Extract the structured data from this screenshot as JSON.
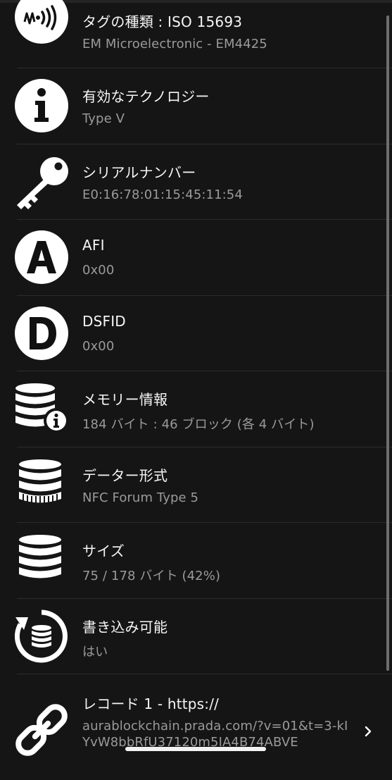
{
  "rows": [
    {
      "title": "タグの種類 : ISO 15693",
      "value": "EM Microelectronic - EM4425",
      "icon": "nfc-tag-icon"
    },
    {
      "title": "有効なテクノロジー",
      "value": "Type V",
      "icon": "info-icon"
    },
    {
      "title": "シリアルナンバー",
      "value": "E0:16:78:01:15:45:11:54",
      "icon": "key-icon"
    },
    {
      "title": "AFI",
      "value": "0x00",
      "icon": "letter-a-icon"
    },
    {
      "title": "DSFID",
      "value": "0x00",
      "icon": "letter-d-icon"
    },
    {
      "title": "メモリー情報",
      "value": "184 バイト : 46 ブロック (各 4 バイト)",
      "icon": "database-info-icon"
    },
    {
      "title": "データー形式",
      "value": "NFC Forum Type 5",
      "icon": "database-format-icon"
    },
    {
      "title": "サイズ",
      "value": "75 / 178 バイト (42%)",
      "icon": "database-size-icon"
    },
    {
      "title": "書き込み可能",
      "value": "はい",
      "icon": "writable-refresh-icon"
    },
    {
      "title": "レコード 1 - https://",
      "value": "aurablockchain.prada.com/?v=01&t=3-kIYvW8bbRfU37120m5IA4B74ABVE",
      "icon": "link-icon"
    }
  ],
  "size_usage_percent": 42
}
